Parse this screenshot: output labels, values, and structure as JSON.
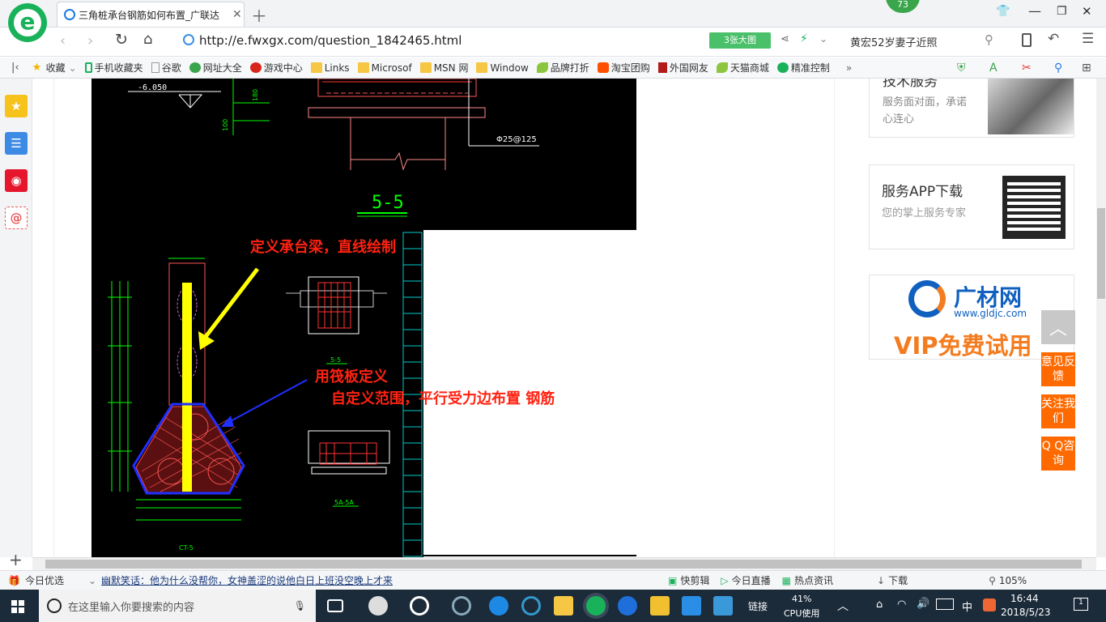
{
  "browser": {
    "tab_title": "三角桩承台钢筋如何布置_广联达",
    "badge_count": "73",
    "url": "http://e.fwxgx.com/question_1842465.html",
    "big_image_btn": "3张大图",
    "search_text": "黄宏52岁妻子近照"
  },
  "bookmarks": [
    {
      "label": "收藏",
      "icon": "star-icon"
    },
    {
      "label": "手机收藏夹",
      "icon": "phone-icon"
    },
    {
      "label": "谷歌",
      "icon": "page-icon"
    },
    {
      "label": "网址大全",
      "icon": "globe-icon"
    },
    {
      "label": "游戏中心",
      "icon": "game-icon"
    },
    {
      "label": "Links",
      "icon": "folder-icon"
    },
    {
      "label": "Microsof",
      "icon": "folder-icon"
    },
    {
      "label": "MSN 网",
      "icon": "folder-icon"
    },
    {
      "label": "Window",
      "icon": "folder-icon"
    },
    {
      "label": "品牌打折",
      "icon": "leaf-icon"
    },
    {
      "label": "淘宝团购",
      "icon": "taobao-icon"
    },
    {
      "label": "外国网友",
      "icon": "bookmark-icon"
    },
    {
      "label": "天猫商城",
      "icon": "leaf-icon"
    },
    {
      "label": "精准控制",
      "icon": "chat-icon"
    }
  ],
  "drawing": {
    "elev": "-6.050",
    "dim180": "180",
    "rebar": "Φ25@125",
    "section": "5-5",
    "ann1": "定义承台梁，直线绘制",
    "ann2": "用筏板定义",
    "ann3": "自定义范围，平行受力边布置 钢筋",
    "sub1": "5-5",
    "sub2": "5A-5A",
    "sub3": "CT-5"
  },
  "sidebar": {
    "card1_heading": "技术服务",
    "card1_text": "服务面对面，承诺心连心",
    "card2_title": "服务APP下载",
    "card2_text": "您的掌上服务专家",
    "ad_brand": "广材网",
    "ad_url": "www.gldjc.com",
    "ad_slogan": "VIP免费试用"
  },
  "float_buttons": [
    "意见反馈",
    "关注我们",
    "Q Q咨询"
  ],
  "status": {
    "today": "今日优选",
    "news": "幽默笑话：他为什么没帮你，女神盖涩的说他白日上班没空晚上才来",
    "kuaijian": "快剪辑",
    "live": "今日直播",
    "hot": "热点资讯",
    "download": "下载",
    "zoom": "105%"
  },
  "taskbar": {
    "search_placeholder": "在这里输入你要搜索的内容",
    "link": "链接",
    "cpu_pct": "41%",
    "cpu_label": "CPU使用",
    "ime": "中",
    "time": "16:44",
    "date": "2018/5/23",
    "notif": "1"
  }
}
